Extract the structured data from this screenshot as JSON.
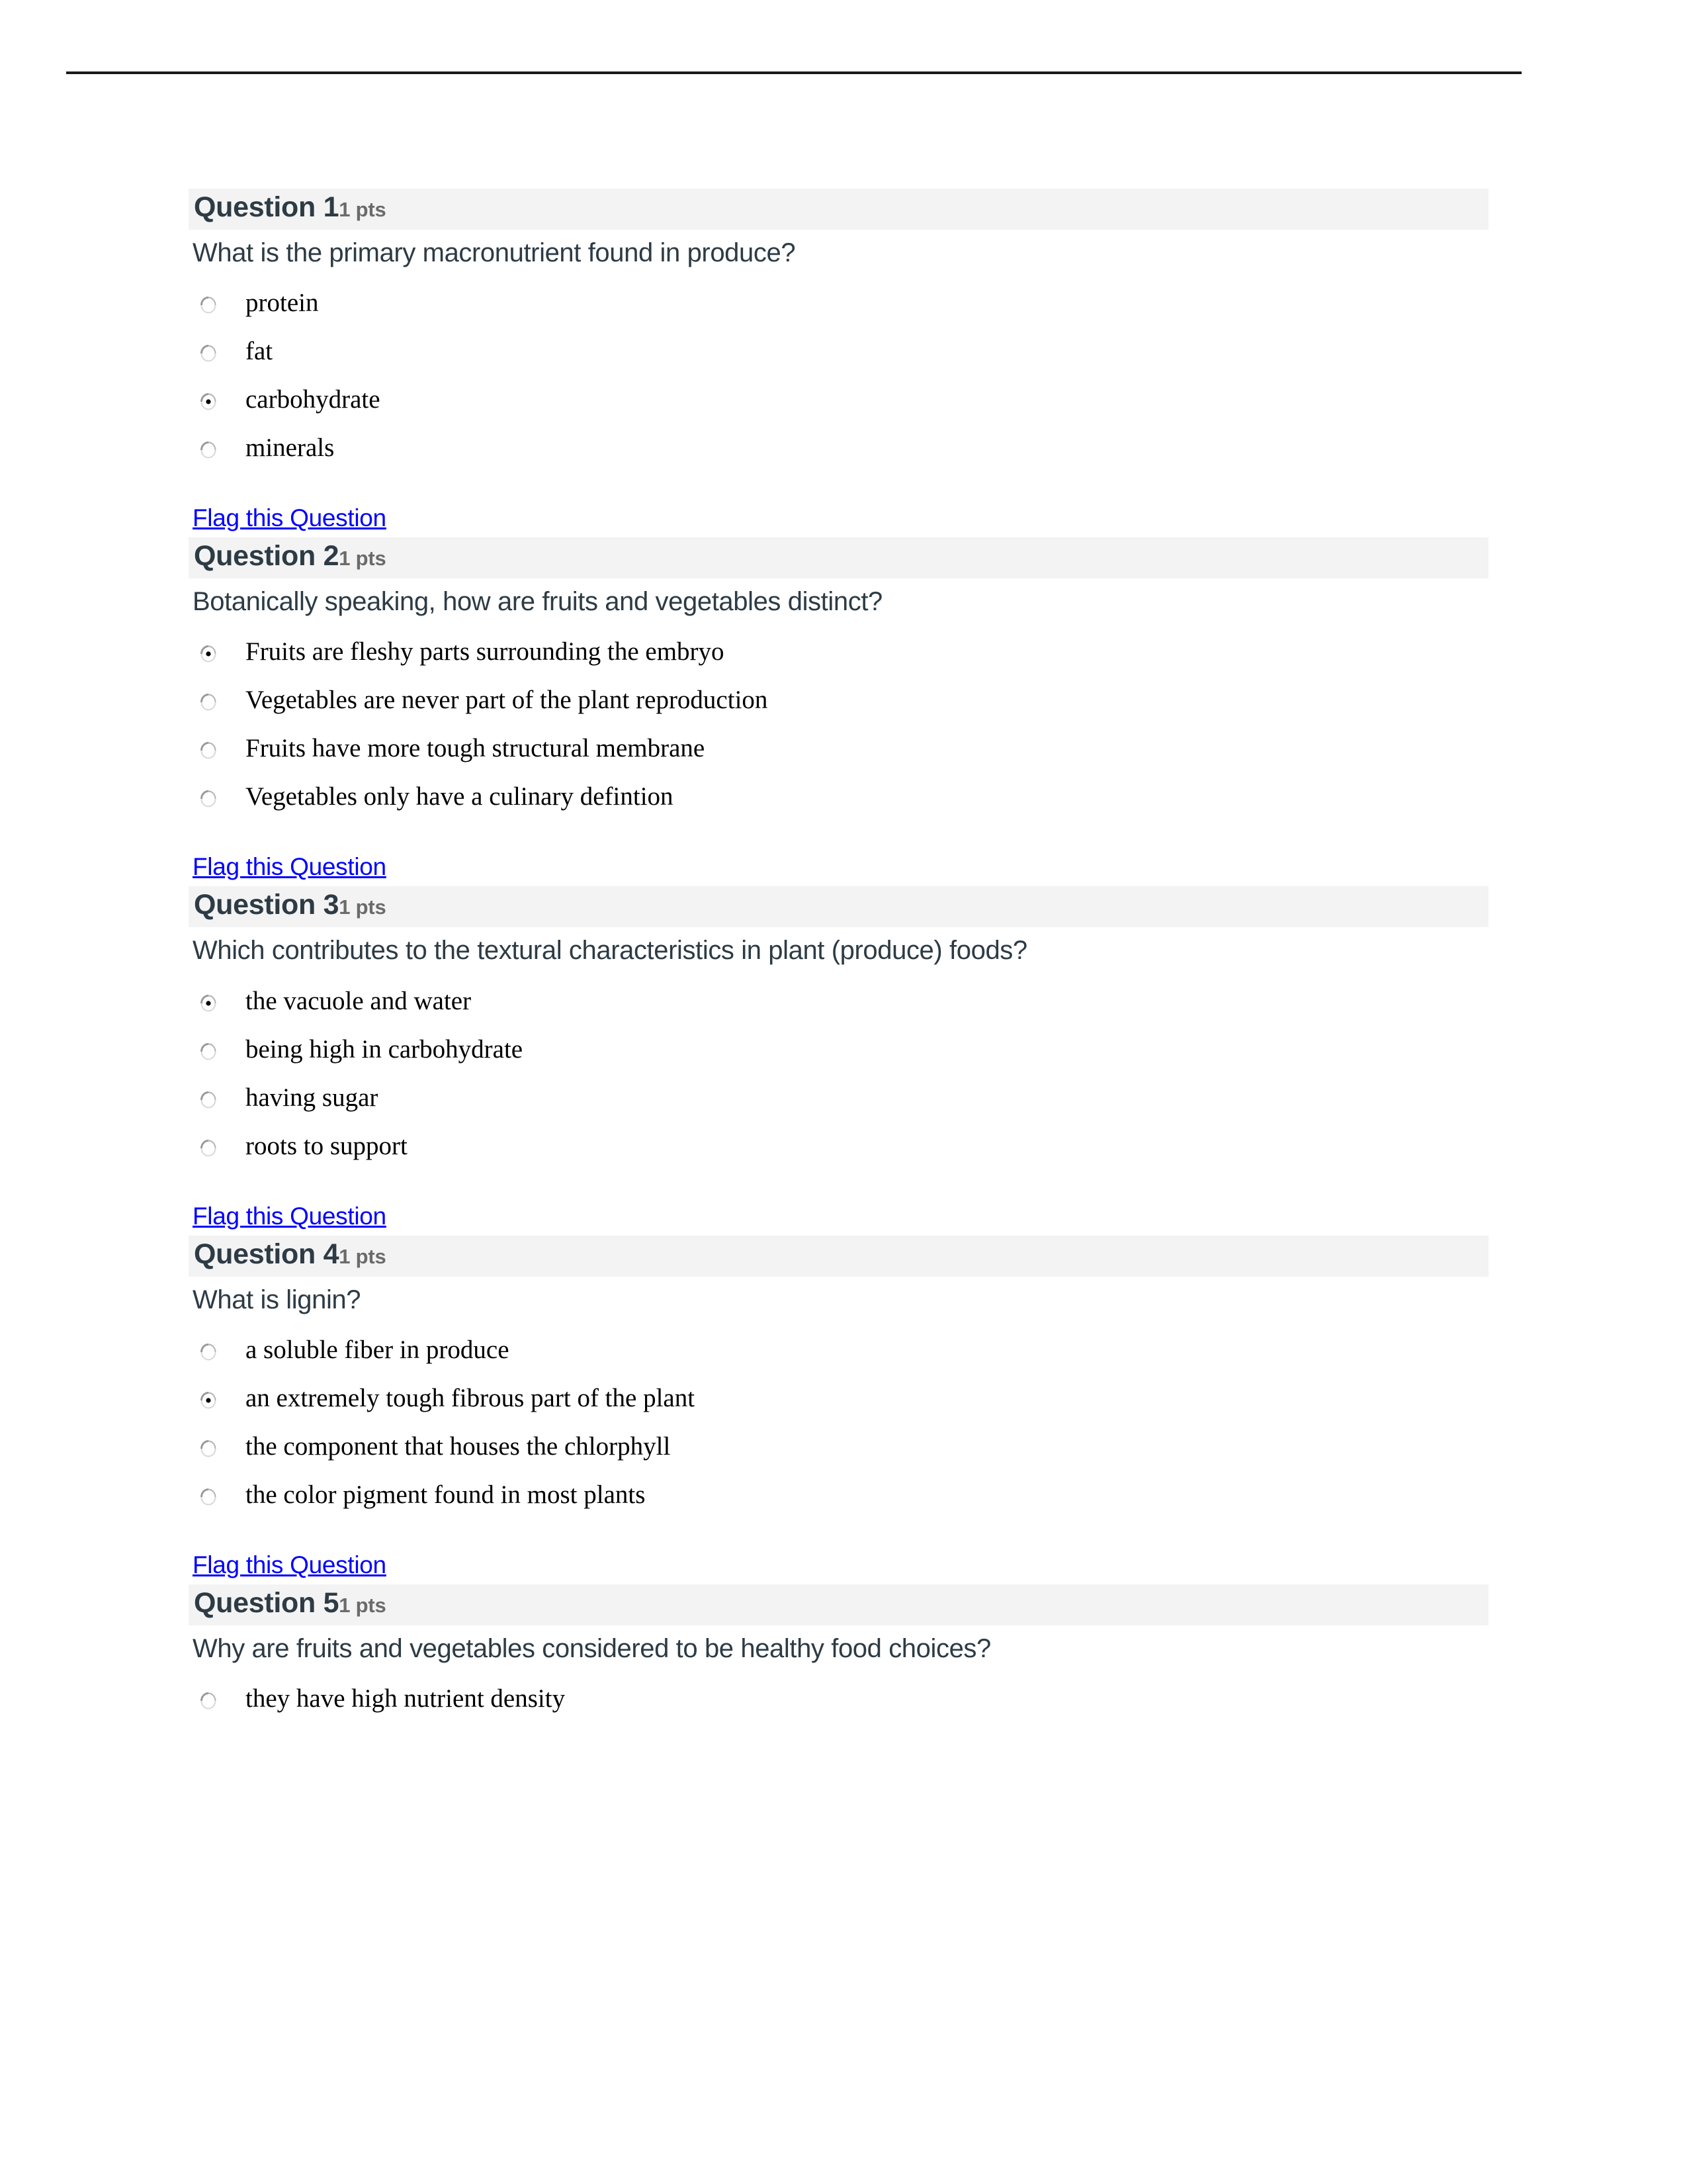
{
  "document": {
    "type": "quiz-printout",
    "colors": {
      "header_band": "#F3F3F3",
      "question_text": "#2D3B45",
      "points_text": "#6B6B6B",
      "link": "#0000FF",
      "answer_text": "#000000",
      "rule": "#1A1A1A"
    },
    "flag_label": "Flag this Question"
  },
  "questions": [
    {
      "title": "Question 1",
      "points": "1 pts",
      "prompt": "What is the primary macronutrient found in produce?",
      "flag_label": "Flag this Question",
      "options": [
        {
          "label": "protein",
          "selected": false
        },
        {
          "label": "fat",
          "selected": false
        },
        {
          "label": "carbohydrate",
          "selected": true
        },
        {
          "label": "minerals",
          "selected": false
        }
      ]
    },
    {
      "title": "Question 2",
      "points": "1 pts",
      "prompt": "Botanically speaking, how are fruits and vegetables distinct?",
      "flag_label": "Flag this Question",
      "options": [
        {
          "label": "Fruits are fleshy parts surrounding the embryo",
          "selected": true
        },
        {
          "label": "Vegetables are never part of the plant reproduction",
          "selected": false
        },
        {
          "label": "Fruits have more tough structural membrane",
          "selected": false
        },
        {
          "label": "Vegetables only have a culinary defintion",
          "selected": false
        }
      ]
    },
    {
      "title": "Question 3",
      "points": "1 pts",
      "prompt": "Which contributes to the textural characteristics in plant (produce) foods?",
      "flag_label": "Flag this Question",
      "options": [
        {
          "label": "the vacuole and water",
          "selected": true
        },
        {
          "label": "being high in carbohydrate",
          "selected": false
        },
        {
          "label": "having sugar",
          "selected": false
        },
        {
          "label": "roots to support",
          "selected": false
        }
      ]
    },
    {
      "title": "Question 4",
      "points": "1 pts",
      "prompt": "What is lignin?",
      "flag_label": "Flag this Question",
      "options": [
        {
          "label": "a soluble fiber in produce",
          "selected": false
        },
        {
          "label": "an extremely tough fibrous part of the plant",
          "selected": true
        },
        {
          "label": "the component that houses the chlorphyll",
          "selected": false
        },
        {
          "label": "the color pigment found in most plants",
          "selected": false
        }
      ]
    },
    {
      "title": "Question 5",
      "points": "1 pts",
      "prompt": "Why are fruits and vegetables considered to be healthy food choices?",
      "flag_label": null,
      "options": [
        {
          "label": "they have high nutrient density",
          "selected": false
        }
      ]
    }
  ]
}
